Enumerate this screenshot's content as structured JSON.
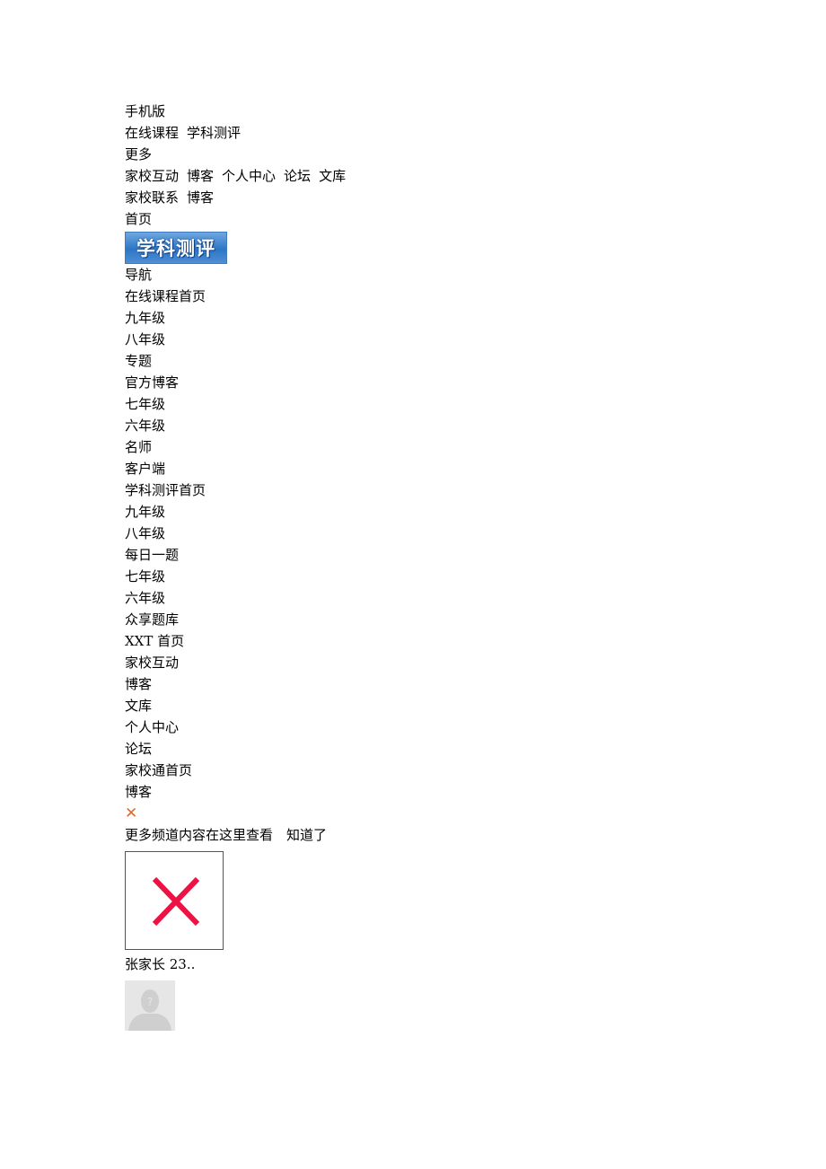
{
  "top_links": {
    "mobile": "手机版",
    "row1": [
      "在线课程",
      "学科测评"
    ],
    "more": "更多",
    "row2": [
      "家校互动",
      "博客",
      "个人中心",
      "论坛",
      "文库"
    ],
    "row3": [
      "家校联系",
      "博客"
    ],
    "home": "首页"
  },
  "logo": {
    "text": "学科测评",
    "icon": "subject-assessment-logo"
  },
  "nav": {
    "title": "导航",
    "items": [
      "在线课程首页",
      "九年级",
      "八年级",
      "专题",
      "官方博客",
      "七年级",
      "六年级",
      "名师",
      "客户端",
      "学科测评首页",
      "九年级",
      "八年级",
      "每日一题",
      "七年级",
      "六年级",
      "众享题库",
      "XXT 首页",
      "家校互动",
      "博客",
      "文库",
      "个人中心",
      "论坛",
      "家校通首页",
      "博客"
    ]
  },
  "tip": {
    "close_icon": "close-icon",
    "close_color": "#e06a2c",
    "message": "更多频道内容在这里查看",
    "ok_label": "知道了"
  },
  "broken_image": {
    "icon": "broken-image-x-icon",
    "color": "#ee1144"
  },
  "user": {
    "name": "张家长 23..",
    "avatar_icon": "default-avatar-icon"
  }
}
